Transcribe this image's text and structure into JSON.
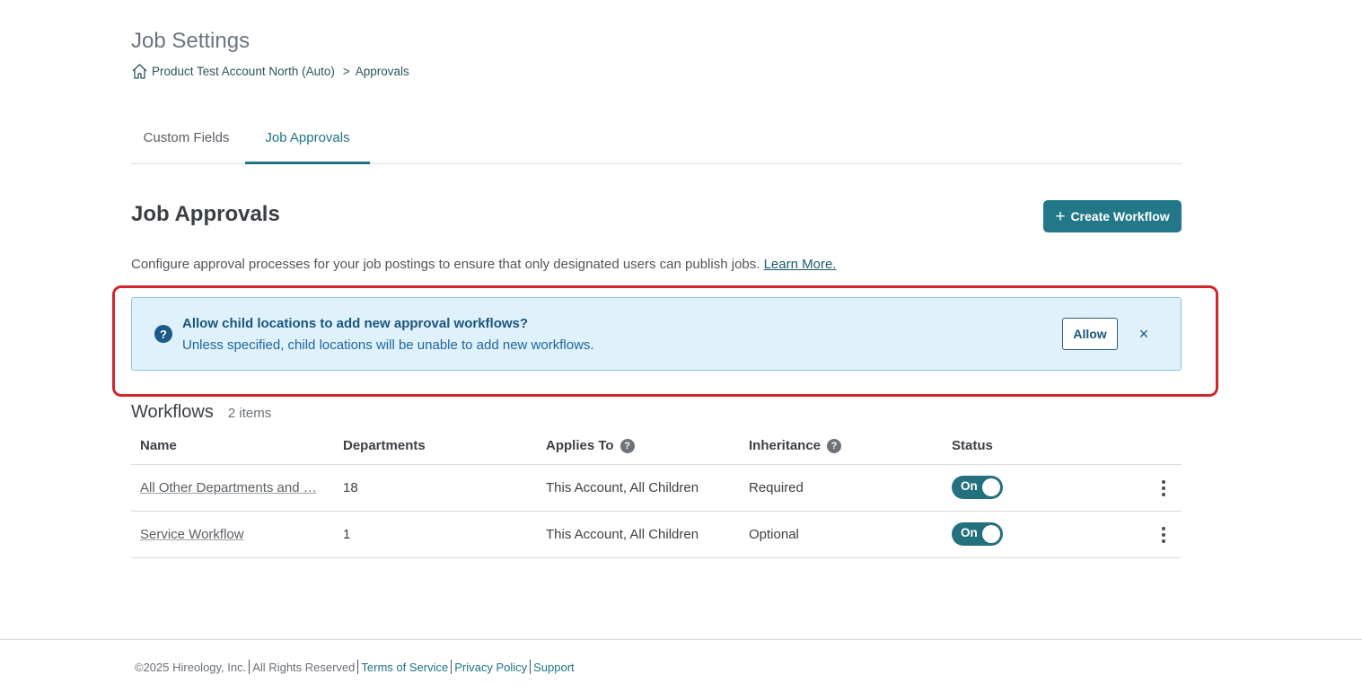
{
  "header": {
    "title": "Job Settings",
    "breadcrumb": {
      "account": "Product Test Account North (Auto)",
      "separator": ">",
      "current": "Approvals"
    }
  },
  "tabs": [
    {
      "label": "Custom Fields",
      "active": false
    },
    {
      "label": "Job Approvals",
      "active": true
    }
  ],
  "section": {
    "title": "Job Approvals",
    "create_button": "Create Workflow",
    "description": "Configure approval processes for your job postings to ensure that only designated users can publish jobs.",
    "learn_more": "Learn More."
  },
  "banner": {
    "title": "Allow child locations to add new approval workflows?",
    "text": "Unless specified, child locations will be unable to add new workflows.",
    "allow_button": "Allow",
    "icon": "question-circle-icon",
    "close": "×"
  },
  "workflows": {
    "title": "Workflows",
    "count": "2 items",
    "columns": {
      "name": "Name",
      "departments": "Departments",
      "applies_to": "Applies To",
      "inheritance": "Inheritance",
      "status": "Status"
    },
    "rows": [
      {
        "name": "All Other Departments and …",
        "departments": "18",
        "applies_to": "This Account, All Children",
        "inheritance": "Required",
        "status": "On"
      },
      {
        "name": "Service Workflow",
        "departments": "1",
        "applies_to": "This Account, All Children",
        "inheritance": "Optional",
        "status": "On"
      }
    ]
  },
  "footer": {
    "copyright": "©2025 Hireology, Inc.",
    "rights": "All Rights Reserved",
    "terms": "Terms of Service",
    "privacy": "Privacy Policy",
    "support": "Support"
  },
  "colors": {
    "primary": "#227888",
    "banner_bg": "#dff1fb",
    "highlight": "#d1262c"
  }
}
